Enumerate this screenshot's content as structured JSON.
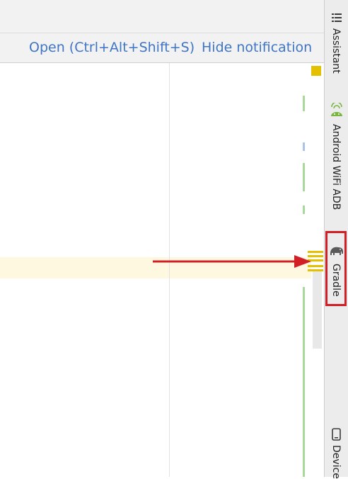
{
  "notification": {
    "open_label": "Open (Ctrl+Alt+Shift+S)",
    "hide_label": "Hide notification"
  },
  "sidebar": {
    "items": [
      {
        "label": "Assistant",
        "icon": "list-icon"
      },
      {
        "label": "Android WiFi ADB",
        "icon": "android-icon"
      },
      {
        "label": "Gradle",
        "icon": "elephant-icon"
      },
      {
        "label": "Device",
        "icon": "phone-icon"
      }
    ]
  },
  "colors": {
    "link": "#3f75c6",
    "highlight_row": "#fff8e1",
    "change_marker": "#a8d89a",
    "warning_marker": "#e3c000",
    "annotation_red": "#d21f26"
  }
}
